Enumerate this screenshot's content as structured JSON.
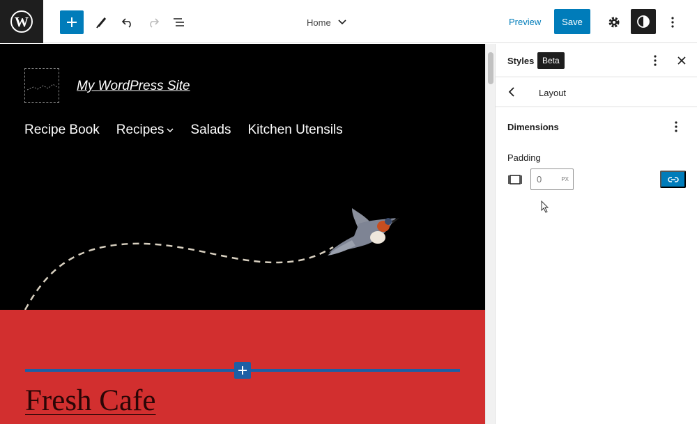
{
  "toolbar": {
    "logo_icon": "wordpress-logo-icon",
    "document_title": "Home",
    "preview_label": "Preview",
    "save_label": "Save",
    "accent_color": "#007cba"
  },
  "site": {
    "title": "My WordPress Site",
    "nav": [
      "Recipe Book",
      "Recipes",
      "Salads",
      "Kitchen Utensils"
    ],
    "heading": "Fresh Cafe",
    "header_color": "#000000",
    "section_color": "#d22f2f"
  },
  "sidebar": {
    "title": "Styles",
    "badge": "Beta",
    "nav_title": "Layout",
    "panel_title": "Dimensions",
    "padding_label": "Padding",
    "padding_value": "0",
    "padding_unit": "PX"
  }
}
